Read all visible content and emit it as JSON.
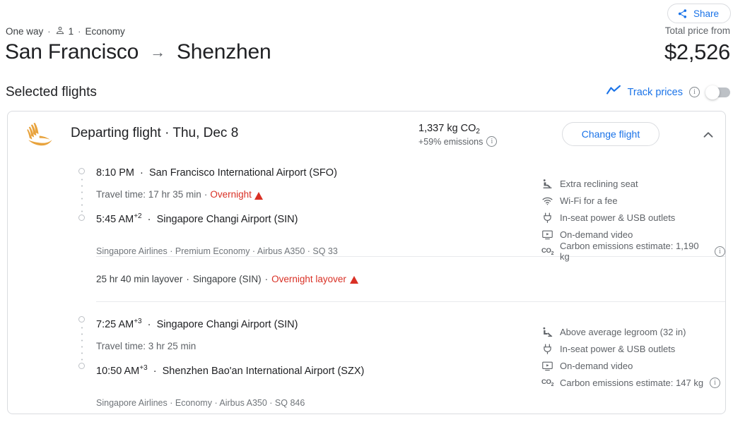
{
  "header": {
    "share_label": "Share",
    "trip_type": "One way",
    "passengers": "1",
    "cabin": "Economy",
    "origin": "San Francisco",
    "destination": "Shenzhen",
    "arrow": "→",
    "separator": "·",
    "total_price_label": "Total price from",
    "total_price": "$2,526",
    "selected_flights_title": "Selected flights",
    "track_prices_label": "Track prices",
    "track_prices_toggle_state": "off",
    "accent_blue": "#1a73e8"
  },
  "card": {
    "airline_logo": "singapore-airlines-logo",
    "logo_color": "#E8A33D",
    "title": "Departing flight  ·  Thu, Dec 8",
    "co2_value": "1,337 kg CO",
    "co2_subscript": "2",
    "co2_emissions_delta": "+59% emissions",
    "change_flight_label": "Change flight",
    "collapse_icon": "chevron-up-icon"
  },
  "segments": [
    {
      "depart_time": "8:10 PM",
      "depart_day_offset": "",
      "depart_airport": "San Francisco International Airport (SFO)",
      "travel_time": "Travel time: 17 hr 35 min",
      "overnight_sep": "·",
      "overnight_label": "Overnight",
      "has_warning": true,
      "arrive_time": "5:45 AM",
      "arrive_day_offset": "+2",
      "arrive_airport": "Singapore Changi Airport (SIN)",
      "airline_details": "Singapore Airlines · Premium Economy · Airbus A350 · SQ 33",
      "amenities": [
        {
          "icon": "reclining-seat-icon",
          "label": "Extra reclining seat",
          "info": false
        },
        {
          "icon": "wifi-icon",
          "label": "Wi-Fi for a fee",
          "info": false
        },
        {
          "icon": "power-plug-icon",
          "label": "In-seat power & USB outlets",
          "info": false
        },
        {
          "icon": "video-icon",
          "label": "On-demand video",
          "info": false
        },
        {
          "icon": "co2-icon",
          "label": "Carbon emissions estimate: 1,190 kg",
          "info": true
        }
      ]
    },
    {
      "depart_time": "7:25 AM",
      "depart_day_offset": "+3",
      "depart_airport": "Singapore Changi Airport (SIN)",
      "travel_time": "Travel time: 3 hr 25 min",
      "overnight_sep": "",
      "overnight_label": "",
      "has_warning": false,
      "arrive_time": "10:50 AM",
      "arrive_day_offset": "+3",
      "arrive_airport": "Shenzhen Bao'an International Airport (SZX)",
      "airline_details": "Singapore Airlines · Economy · Airbus A350 · SQ 846",
      "amenities": [
        {
          "icon": "legroom-icon",
          "label": "Above average legroom (32 in)",
          "info": false
        },
        {
          "icon": "power-plug-icon",
          "label": "In-seat power & USB outlets",
          "info": false
        },
        {
          "icon": "video-icon",
          "label": "On-demand video",
          "info": false
        },
        {
          "icon": "co2-icon",
          "label": "Carbon emissions estimate: 147 kg",
          "info": true
        }
      ]
    }
  ],
  "layover": {
    "duration": "25 hr 40 min layover",
    "sep1": "·",
    "location": "Singapore (SIN)",
    "sep2": "·",
    "warning_label": "Overnight layover",
    "warning_color": "#d93025"
  }
}
